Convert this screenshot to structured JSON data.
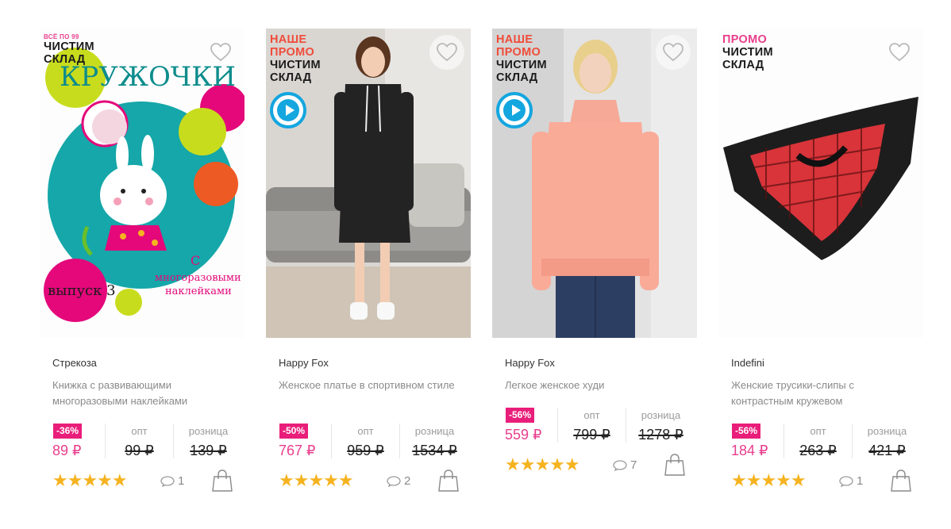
{
  "products": [
    {
      "labels": [
        "Чистим",
        "склад"
      ],
      "mini_label": "Всё по 99",
      "brand": "Стрекоза",
      "description": "Книжка с развивающими многоразовыми наклейками",
      "cover": {
        "title": "КРУЖОЧКИ",
        "sticker_text_1": "С",
        "sticker_text_2": "многоразовыми",
        "sticker_text_3": "наклейками",
        "issue": "выпуск 3"
      },
      "discount": "-36%",
      "opt_label": "опт",
      "retail_label": "розница",
      "price": "89 ₽",
      "opt_price": "99 ₽",
      "retail_price": "139 ₽",
      "rating": 5,
      "stars": "★★★★★",
      "comments": "1",
      "has_video": false
    },
    {
      "labels_red": [
        "Наше",
        "промо"
      ],
      "labels": [
        "Чистим",
        "склад"
      ],
      "brand": "Happy Fox",
      "description": "Женское платье в спортивном стиле",
      "discount": "-50%",
      "opt_label": "опт",
      "retail_label": "розница",
      "price": "767 ₽",
      "opt_price": "959 ₽",
      "retail_price": "1534 ₽",
      "rating": 5,
      "stars": "★★★★★",
      "comments": "2",
      "has_video": true
    },
    {
      "labels_red": [
        "Наше",
        "промо"
      ],
      "labels": [
        "Чистим",
        "склад"
      ],
      "brand": "Happy Fox",
      "description": "Легкое женское худи",
      "discount": "-56%",
      "opt_label": "опт",
      "retail_label": "розница",
      "price": "559 ₽",
      "opt_price": "799 ₽",
      "retail_price": "1278 ₽",
      "rating": 5,
      "stars": "★★★★★",
      "comments": "7",
      "has_video": true
    },
    {
      "labels_pink": [
        "Промо"
      ],
      "labels": [
        "Чистим",
        "склад"
      ],
      "brand": "Indefini",
      "description": "Женские трусики-слипы с контрастным кружевом",
      "discount": "-56%",
      "opt_label": "опт",
      "retail_label": "розница",
      "price": "184 ₽",
      "opt_price": "263 ₽",
      "retail_price": "421 ₽",
      "rating": 5,
      "stars": "★★★★★",
      "comments": "1",
      "has_video": false
    }
  ],
  "colors": {
    "discount_bg": "#e91e7a",
    "sale_price": "#e83e8c",
    "promo_red": "#f04c3a",
    "promo_pink": "#e83e8c",
    "star": "#f5b320",
    "play": "#14a6df"
  },
  "icons": {
    "favorite": "heart-outline-icon",
    "comment": "speech-bubble-icon",
    "cart": "shopping-bag-icon",
    "video": "play-icon",
    "rating": "star-icon"
  }
}
